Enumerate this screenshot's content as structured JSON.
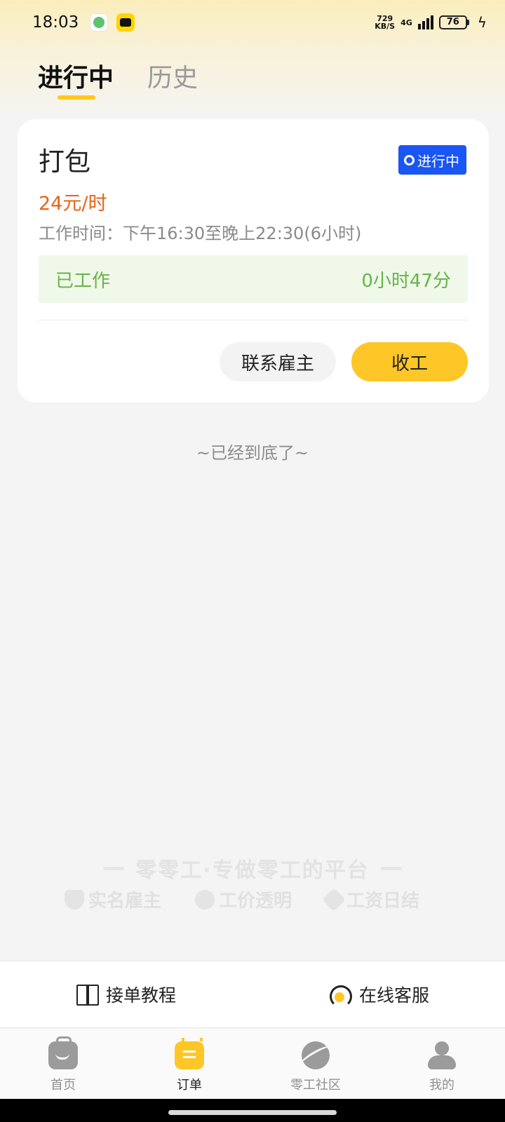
{
  "status_bar": {
    "time": "18:03",
    "net_speed_value": "729",
    "net_speed_unit": "KB/S",
    "network": "4G",
    "battery": "76"
  },
  "tabs": [
    {
      "label": "进行中",
      "active": true
    },
    {
      "label": "历史",
      "active": false
    }
  ],
  "order_card": {
    "title": "打包",
    "status": "进行中",
    "wage": "24元/时",
    "work_time": "工作时间：下午16:30至晚上22:30(6小时)",
    "worked_label": "已工作",
    "worked_value": "0小时47分",
    "contact_button": "联系雇主",
    "finish_button": "收工"
  },
  "list_end_text": "~已经到底了~",
  "watermark": {
    "slogan": "零零工·专做零工的平台",
    "features": [
      "实名雇主",
      "工价透明",
      "工资日结"
    ]
  },
  "help_bar": {
    "tutorial": "接单教程",
    "support": "在线客服"
  },
  "bottom_nav": [
    {
      "label": "首页",
      "icon": "home-bag-icon"
    },
    {
      "label": "订单",
      "icon": "order-icon",
      "active": true
    },
    {
      "label": "零工社区",
      "icon": "planet-icon"
    },
    {
      "label": "我的",
      "icon": "profile-icon"
    }
  ],
  "colors": {
    "accent": "#ffc627",
    "status_badge": "#1a55f5",
    "wage": "#e5641c",
    "worked_text": "#67b447"
  }
}
